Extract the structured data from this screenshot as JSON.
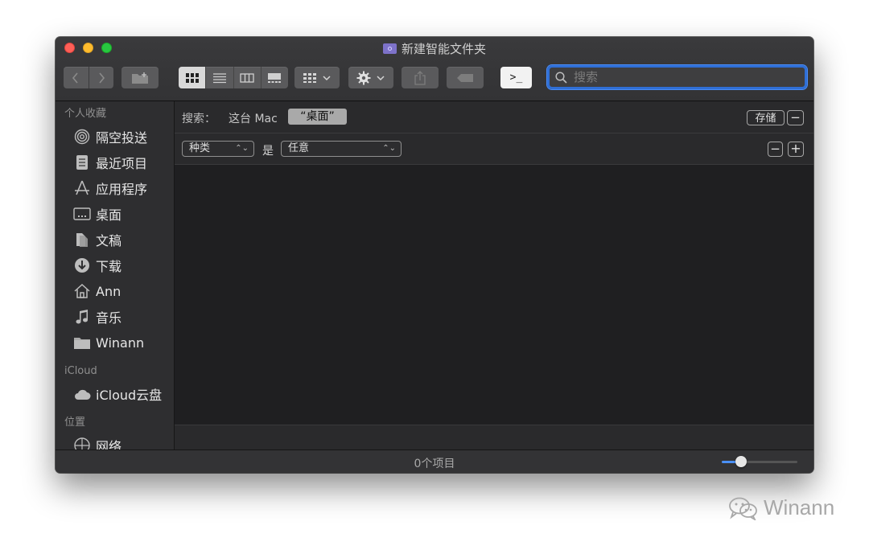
{
  "window": {
    "title": "新建智能文件夹"
  },
  "toolbar": {
    "back_icon": "chevron-left-icon",
    "forward_icon": "chevron-right-icon",
    "terminal_label": ">_",
    "search_placeholder": "搜索"
  },
  "sidebar": {
    "sections": [
      {
        "title": "个人收藏",
        "items": [
          {
            "label": "隔空投送",
            "icon": "airdrop-icon"
          },
          {
            "label": "最近项目",
            "icon": "recents-icon"
          },
          {
            "label": "应用程序",
            "icon": "applications-icon"
          },
          {
            "label": "桌面",
            "icon": "desktop-icon"
          },
          {
            "label": "文稿",
            "icon": "documents-icon"
          },
          {
            "label": "下载",
            "icon": "downloads-icon"
          },
          {
            "label": "Ann",
            "icon": "home-icon"
          },
          {
            "label": "音乐",
            "icon": "music-icon"
          },
          {
            "label": "Winann",
            "icon": "folder-icon"
          }
        ]
      },
      {
        "title": "iCloud",
        "items": [
          {
            "label": "iCloud云盘",
            "icon": "cloud-icon"
          }
        ]
      },
      {
        "title": "位置",
        "items": [
          {
            "label": "网络",
            "icon": "network-icon"
          }
        ]
      }
    ]
  },
  "search_scope": {
    "label": "搜索：",
    "this_mac": "这台 Mac",
    "desktop": "“桌面”",
    "save_label": "存储",
    "remove_label": "−"
  },
  "criteria": {
    "attribute": "种类",
    "operator": "是",
    "value": "任意",
    "remove_label": "−",
    "add_label": "+"
  },
  "status": {
    "item_count": "0个项目",
    "icon_size_level": 0.25
  },
  "watermark": {
    "text": "Winann"
  }
}
